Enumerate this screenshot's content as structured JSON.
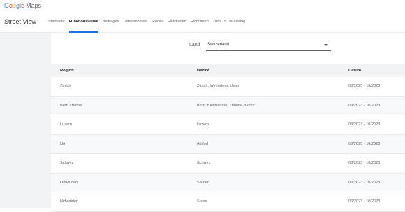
{
  "app": {
    "logo_google": [
      "G",
      "o",
      "o",
      "g",
      "l",
      "e"
    ],
    "logo_product": "Maps",
    "section_title": "Street View"
  },
  "nav": {
    "tabs": [
      {
        "label": "Startseite",
        "active": false
      },
      {
        "label": "Funktionsweise",
        "active": true
      },
      {
        "label": "Beitragen",
        "active": false
      },
      {
        "label": "Unternehmen",
        "active": false
      },
      {
        "label": "Stories",
        "active": false
      },
      {
        "label": "Fallstudien",
        "active": false
      },
      {
        "label": "Richtlinien",
        "active": false
      },
      {
        "label": "Zum 15. Jahrestag",
        "active": false
      }
    ]
  },
  "filter": {
    "label": "Land",
    "selected": "Switzerland"
  },
  "table": {
    "headers": [
      "Region",
      "Bezirk",
      "Datum"
    ],
    "rows": [
      [
        "Zürich",
        "Zürich, Winterthur, Uster",
        "03/2023 - 10/2023"
      ],
      [
        "Bern / Berne",
        "Bern, Biel/Bienne, Thoune, Köniz",
        "03/2023 - 10/2023"
      ],
      [
        "Luzern",
        "Luzern",
        "03/2023 - 10/2023"
      ],
      [
        "Uri",
        "Altdorf",
        "03/2023 - 10/2023"
      ],
      [
        "Schwyz",
        "Schwyz",
        "03/2023 - 10/2023"
      ],
      [
        "Obwalden",
        "Sarnen",
        "03/2023 - 10/2023"
      ],
      [
        "Nidwalden",
        "Stans",
        "03/2023 - 10/2023"
      ]
    ]
  },
  "colors": {
    "accent": "#1a73e8",
    "header_bg": "#f1f3f4",
    "left_panel_bg": "#f1f3f4"
  }
}
